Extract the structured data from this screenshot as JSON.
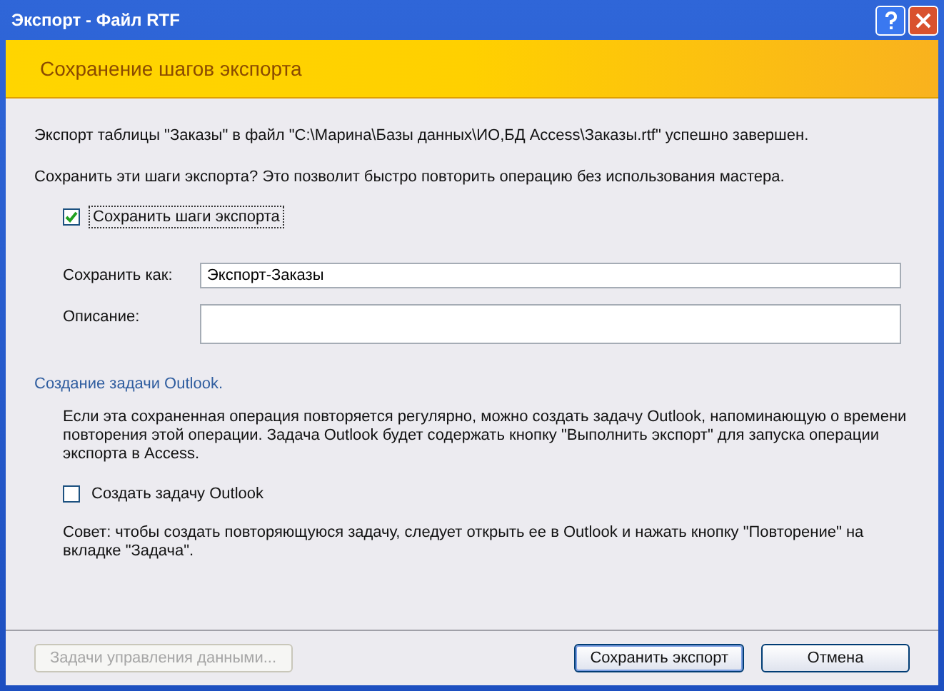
{
  "window": {
    "title": "Экспорт - Файл RTF"
  },
  "banner": {
    "title": "Сохранение шагов экспорта"
  },
  "status_text": "Экспорт таблицы \"Заказы\" в файл \"C:\\Марина\\Базы данных\\ИО,БД Access\\Заказы.rtf\" успешно завершен.",
  "question": "Сохранить эти шаги экспорта? Это позволит быстро повторить операцию без использования мастера.",
  "save_steps": {
    "label": "Сохранить шаги экспорта",
    "checked": true
  },
  "fields": [
    {
      "label": "Сохранить как:",
      "value": "Экспорт-Заказы"
    },
    {
      "label": "Описание:"
    }
  ],
  "outlook": {
    "heading": "Создание задачи Outlook.",
    "text": "Если эта сохраненная операция повторяется регулярно, можно создать задачу Outlook, напоминающую о времени повторения этой операции. Задача Outlook будет содержать кнопку \"Выполнить экспорт\" для запуска операции экспорта в Access.",
    "checkbox": {
      "label": "Создать задачу Outlook",
      "checked": false
    },
    "tip": "Совет: чтобы создать повторяющуюся задачу, следует открыть ее в Outlook и нажать кнопку \"Повторение\" на вкладке \"Задача\"."
  },
  "buttons": [
    {
      "label": "Задачи управления данными...",
      "disabled": true
    },
    {
      "label": "Сохранить экспорт",
      "disabled": false
    },
    {
      "label": "Отмена",
      "disabled": false
    }
  ]
}
